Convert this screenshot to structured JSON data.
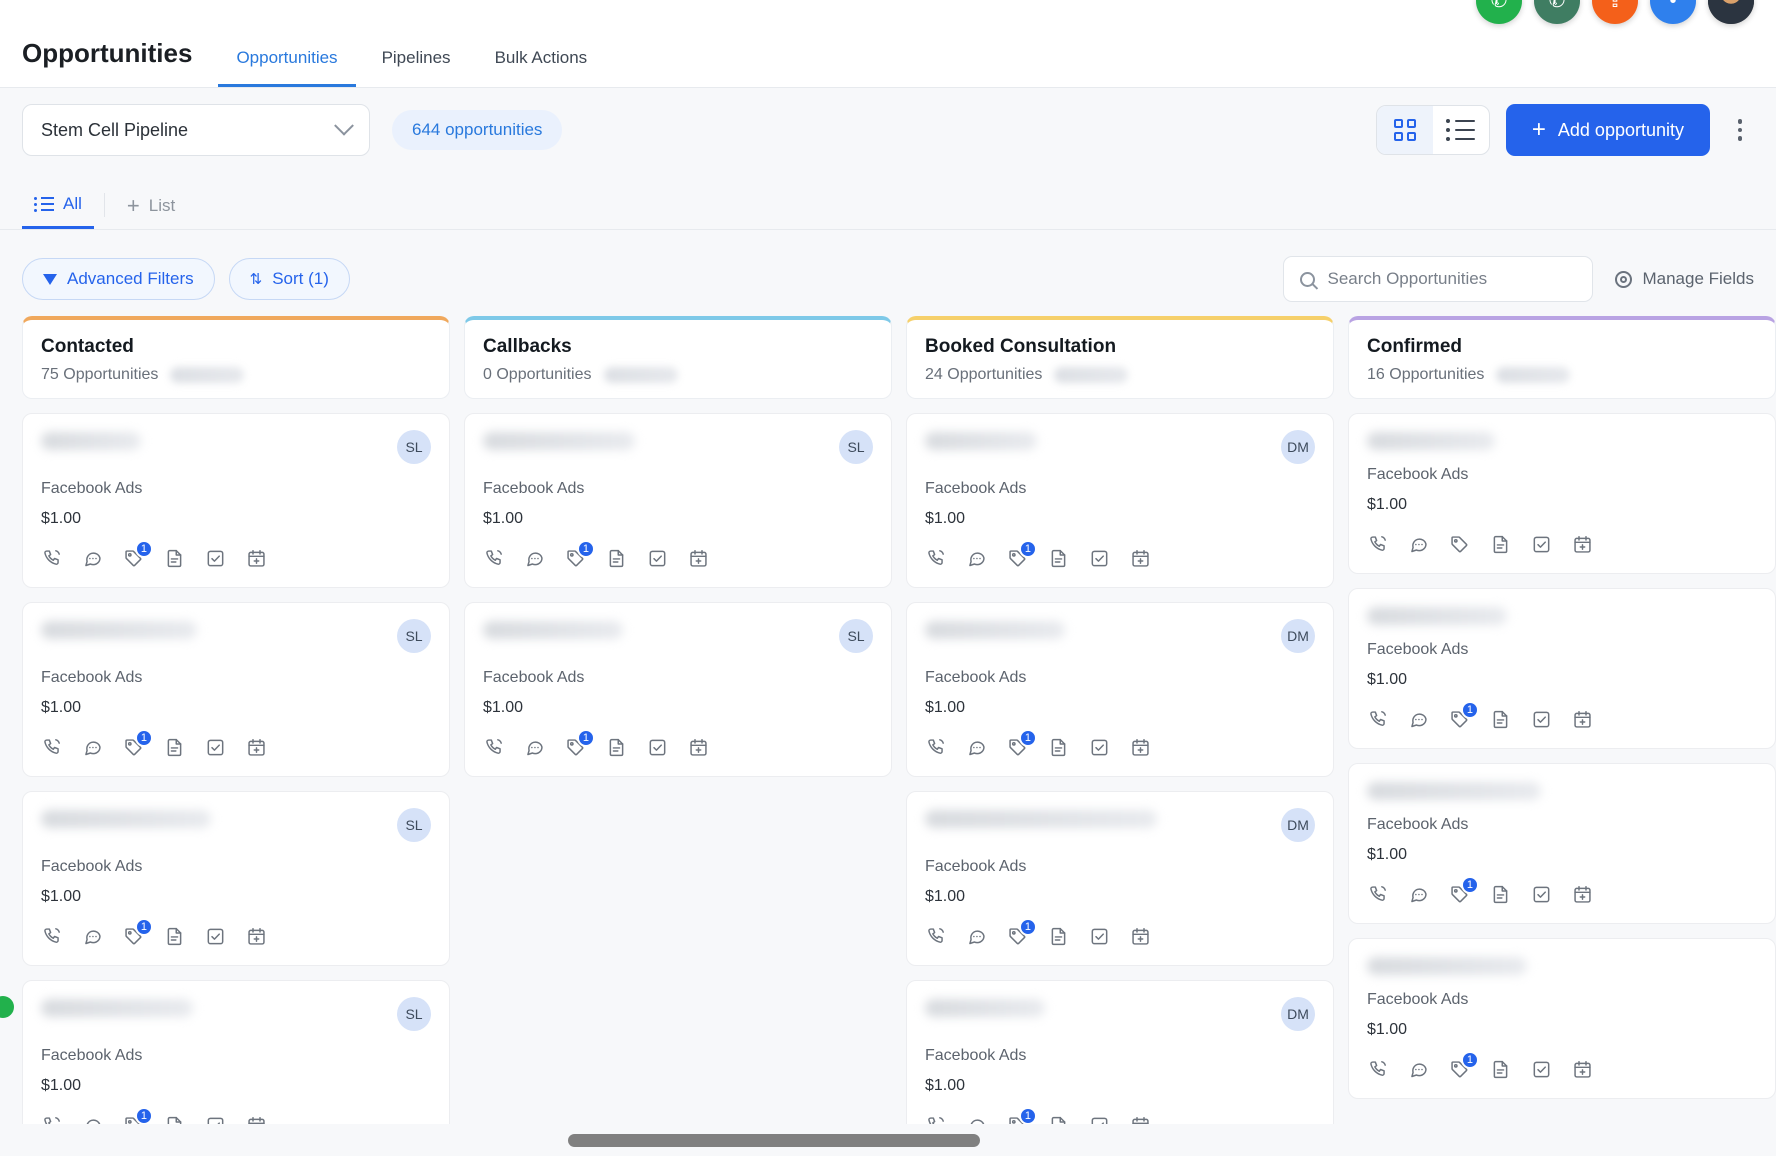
{
  "header": {
    "title": "Opportunities",
    "tabs": [
      {
        "label": "Opportunities",
        "active": true
      },
      {
        "label": "Pipelines",
        "active": false
      },
      {
        "label": "Bulk Actions",
        "active": false
      }
    ]
  },
  "toolbar": {
    "pipeline_value": "Stem Cell Pipeline",
    "opportunity_count": "644 opportunities",
    "grid_view_icon": "grid-view-icon",
    "list_view_icon": "list-view-icon",
    "add_label": "Add opportunity",
    "more_icon": "kebab-menu-icon"
  },
  "list_tabs": {
    "all_label": "All",
    "add_list_label": "List"
  },
  "filters": {
    "advanced_label": "Advanced Filters",
    "sort_label": "Sort (1)",
    "search_placeholder": "Search Opportunities",
    "search_value": "",
    "manage_fields_label": "Manage Fields"
  },
  "colors": {
    "accent": "#2563eb",
    "contacted": "#f0a85c",
    "callbacks": "#7ec9e8",
    "booked": "#f6d06a",
    "confirmed": "#b9a3e3"
  },
  "columns": [
    {
      "title": "Contacted",
      "subtitle": "75 Opportunities",
      "accent": "#f0a85c",
      "cards": [
        {
          "name_width": 100,
          "source": "Facebook Ads",
          "value": "$1.00",
          "avatar": "SL",
          "badge": "1"
        },
        {
          "name_width": 156,
          "source": "Facebook Ads",
          "value": "$1.00",
          "avatar": "SL",
          "badge": "1"
        },
        {
          "name_width": 170,
          "source": "Facebook Ads",
          "value": "$1.00",
          "avatar": "SL",
          "badge": "1"
        },
        {
          "name_width": 152,
          "source": "Facebook Ads",
          "value": "$1.00",
          "avatar": "SL",
          "badge": "1"
        }
      ]
    },
    {
      "title": "Callbacks",
      "subtitle": "0 Opportunities",
      "accent": "#7ec9e8",
      "cards": [
        {
          "name_width": 152,
          "source": "Facebook Ads",
          "value": "$1.00",
          "avatar": "SL",
          "badge": "1"
        },
        {
          "name_width": 140,
          "source": "Facebook Ads",
          "value": "$1.00",
          "avatar": "SL",
          "badge": "1"
        }
      ]
    },
    {
      "title": "Booked Consultation",
      "subtitle": "24 Opportunities",
      "accent": "#f6d06a",
      "cards": [
        {
          "name_width": 112,
          "source": "Facebook Ads",
          "value": "$1.00",
          "avatar": "DM",
          "badge": "1"
        },
        {
          "name_width": 140,
          "source": "Facebook Ads",
          "value": "$1.00",
          "avatar": "DM",
          "badge": "1"
        },
        {
          "name_width": 232,
          "source": "Facebook Ads",
          "value": "$1.00",
          "avatar": "DM",
          "badge": "1"
        },
        {
          "name_width": 120,
          "source": "Facebook Ads",
          "value": "$1.00",
          "avatar": "DM",
          "badge": "1"
        }
      ]
    },
    {
      "title": "Confirmed",
      "subtitle": "16 Opportunities",
      "accent": "#b9a3e3",
      "cards": [
        {
          "name_width": 128,
          "source": "Facebook Ads",
          "value": "$1.00",
          "avatar": "",
          "badge": ""
        },
        {
          "name_width": 140,
          "source": "Facebook Ads",
          "value": "$1.00",
          "avatar": "",
          "badge": "1"
        },
        {
          "name_width": 174,
          "source": "Facebook Ads",
          "value": "$1.00",
          "avatar": "",
          "badge": "1"
        },
        {
          "name_width": 160,
          "source": "Facebook Ads",
          "value": "$1.00",
          "avatar": "",
          "badge": "1"
        }
      ]
    }
  ],
  "card_icons": [
    "phone-icon",
    "chat-icon",
    "tag-icon",
    "document-icon",
    "task-checkbox-icon",
    "calendar-add-icon"
  ],
  "fabs": [
    "whatsapp-fab",
    "phone-fab",
    "upload-fab",
    "info-fab",
    "user-avatar-fab"
  ]
}
